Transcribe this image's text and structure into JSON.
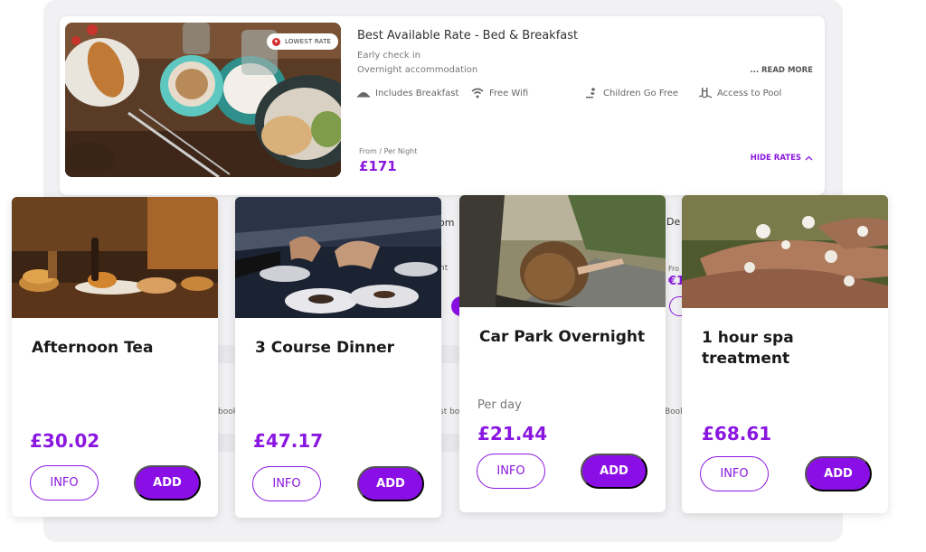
{
  "room": {
    "badge": "LOWEST RATE",
    "title": "Best Available Rate - Bed & Breakfast",
    "lines": [
      "Early check in",
      "Overnight accommodation"
    ],
    "read_more": "... READ MORE",
    "amenities": [
      {
        "label": "Includes Breakfast",
        "icon": "breakfast-icon"
      },
      {
        "label": "Free Wifi",
        "icon": "wifi-icon"
      },
      {
        "label": "Children Go Free",
        "icon": "child-icon"
      },
      {
        "label": "Access to Pool",
        "icon": "pool-icon"
      }
    ],
    "from_label": "From / Per Night",
    "price": "£171",
    "hide_rates": "HIDE RATES"
  },
  "peek": {
    "t1": "om",
    "t2": "ht",
    "t3": "De",
    "t4": "Fro",
    "t5": "€1",
    "b1": "book",
    "b2": "st bo",
    "b3": "Book"
  },
  "extras": [
    {
      "title": "Afternoon Tea",
      "sub": "",
      "price": "£30.02",
      "info": "INFO",
      "add": "ADD"
    },
    {
      "title": "3 Course Dinner",
      "sub": "",
      "price": "£47.17",
      "info": "INFO",
      "add": "ADD"
    },
    {
      "title": "Car Park Overnight",
      "sub": "Per day",
      "price": "£21.44",
      "info": "INFO",
      "add": "ADD"
    },
    {
      "title": "1 hour spa treatment",
      "sub": "",
      "price": "£68.61",
      "info": "INFO",
      "add": "ADD"
    }
  ],
  "colors": {
    "accent": "#8a17e0",
    "badge": "#d32f2f"
  }
}
